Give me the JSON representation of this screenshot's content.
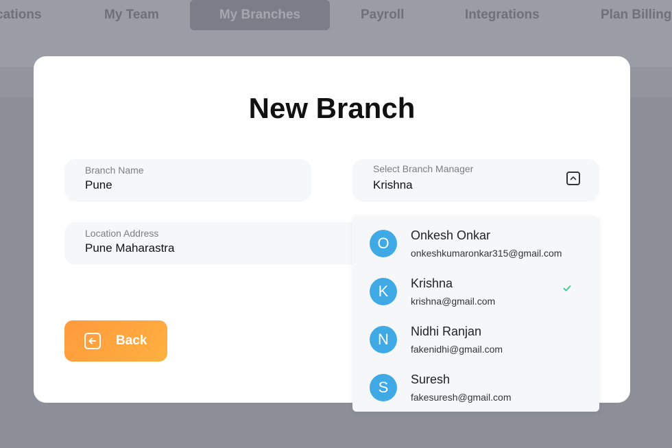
{
  "nav": {
    "tabs": [
      {
        "label": "cations"
      },
      {
        "label": "My Team"
      },
      {
        "label": "My Branches"
      },
      {
        "label": "Payroll"
      },
      {
        "label": "Integrations"
      },
      {
        "label": "Plan Billing"
      }
    ],
    "active_tab": "My Branches"
  },
  "modal": {
    "title": "New Branch",
    "branch_name": {
      "label": "Branch Name",
      "value": "Pune"
    },
    "location": {
      "label": "Location Address",
      "value": "Pune Maharastra"
    },
    "manager": {
      "label": "Select Branch Manager",
      "value": "Krishna"
    },
    "back_label": "Back"
  },
  "dropdown": {
    "options": [
      {
        "initial": "O",
        "name": "Onkesh Onkar",
        "email": "onkeshkumaronkar315@gmail.com",
        "selected": false
      },
      {
        "initial": "K",
        "name": "Krishna",
        "email": "krishna@gmail.com",
        "selected": true
      },
      {
        "initial": "N",
        "name": "Nidhi Ranjan",
        "email": "fakenidhi@gmail.com",
        "selected": false
      },
      {
        "initial": "S",
        "name": "Suresh",
        "email": "fakesuresh@gmail.com",
        "selected": false
      }
    ]
  },
  "colors": {
    "accent_orange": "#ff9a3c",
    "avatar_blue": "#3fa9e6",
    "check_green": "#3ecf8e",
    "overlay": "#8c8f98"
  },
  "icons": {
    "chevron": "chevron-up-icon",
    "back": "arrow-left-box-icon",
    "check": "check-icon"
  }
}
